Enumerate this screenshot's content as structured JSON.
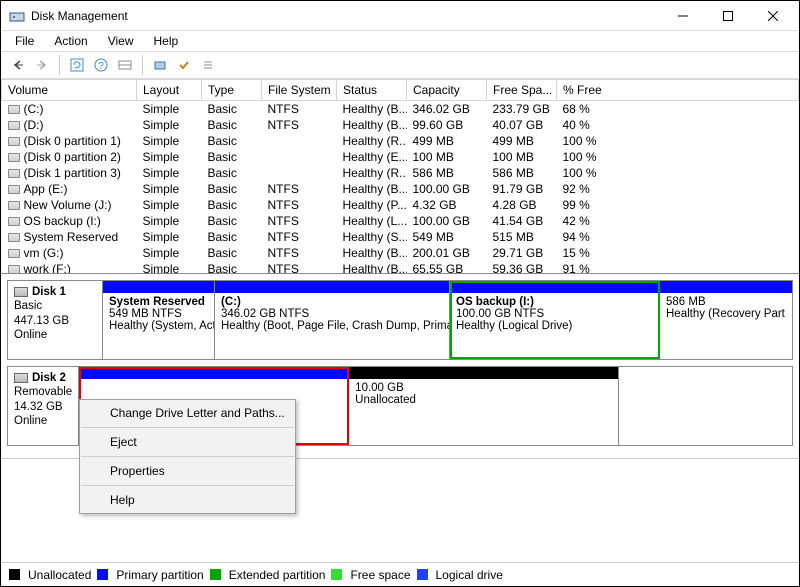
{
  "window": {
    "title": "Disk Management"
  },
  "menu": {
    "file": "File",
    "action": "Action",
    "view": "View",
    "help": "Help"
  },
  "columns": {
    "volume": "Volume",
    "layout": "Layout",
    "type": "Type",
    "fs": "File System",
    "status": "Status",
    "capacity": "Capacity",
    "free": "Free Spa...",
    "pct": "% Free"
  },
  "volumes": [
    {
      "name": "(C:)",
      "layout": "Simple",
      "type": "Basic",
      "fs": "NTFS",
      "status": "Healthy (B...",
      "cap": "346.02 GB",
      "free": "233.79 GB",
      "pct": "68 %"
    },
    {
      "name": "(D:)",
      "layout": "Simple",
      "type": "Basic",
      "fs": "NTFS",
      "status": "Healthy (B...",
      "cap": "99.60 GB",
      "free": "40.07 GB",
      "pct": "40 %"
    },
    {
      "name": "(Disk 0 partition 1)",
      "layout": "Simple",
      "type": "Basic",
      "fs": "",
      "status": "Healthy (R...",
      "cap": "499 MB",
      "free": "499 MB",
      "pct": "100 %"
    },
    {
      "name": "(Disk 0 partition 2)",
      "layout": "Simple",
      "type": "Basic",
      "fs": "",
      "status": "Healthy (E...",
      "cap": "100 MB",
      "free": "100 MB",
      "pct": "100 %"
    },
    {
      "name": "(Disk 1 partition 3)",
      "layout": "Simple",
      "type": "Basic",
      "fs": "",
      "status": "Healthy (R...",
      "cap": "586 MB",
      "free": "586 MB",
      "pct": "100 %"
    },
    {
      "name": "App (E:)",
      "layout": "Simple",
      "type": "Basic",
      "fs": "NTFS",
      "status": "Healthy (B...",
      "cap": "100.00 GB",
      "free": "91.79 GB",
      "pct": "92 %"
    },
    {
      "name": "New Volume (J:)",
      "layout": "Simple",
      "type": "Basic",
      "fs": "NTFS",
      "status": "Healthy (P...",
      "cap": "4.32 GB",
      "free": "4.28 GB",
      "pct": "99 %"
    },
    {
      "name": "OS backup (I:)",
      "layout": "Simple",
      "type": "Basic",
      "fs": "NTFS",
      "status": "Healthy (L...",
      "cap": "100.00 GB",
      "free": "41.54 GB",
      "pct": "42 %"
    },
    {
      "name": "System Reserved",
      "layout": "Simple",
      "type": "Basic",
      "fs": "NTFS",
      "status": "Healthy (S...",
      "cap": "549 MB",
      "free": "515 MB",
      "pct": "94 %"
    },
    {
      "name": "vm (G:)",
      "layout": "Simple",
      "type": "Basic",
      "fs": "NTFS",
      "status": "Healthy (B...",
      "cap": "200.01 GB",
      "free": "29.71 GB",
      "pct": "15 %"
    },
    {
      "name": "work (F:)",
      "layout": "Simple",
      "type": "Basic",
      "fs": "NTFS",
      "status": "Healthy (B...",
      "cap": "65.55 GB",
      "free": "59.36 GB",
      "pct": "91 %"
    }
  ],
  "disks": {
    "d1": {
      "name": "Disk 1",
      "type": "Basic",
      "size": "447.13 GB",
      "state": "Online"
    },
    "d2": {
      "name": "Disk 2",
      "type": "Removable",
      "size": "14.32 GB",
      "state": "Online"
    }
  },
  "d1parts": {
    "p0": {
      "name": "System Reserved",
      "line2": "549 MB NTFS",
      "line3": "Healthy (System, Activ"
    },
    "p1": {
      "name": "(C:)",
      "line2": "346.02 GB NTFS",
      "line3": "Healthy (Boot, Page File, Crash Dump, Primary P"
    },
    "p2": {
      "name": "OS backup  (I:)",
      "line2": "100.00 GB NTFS",
      "line3": "Healthy (Logical Drive)"
    },
    "p3": {
      "name": "",
      "line2": "586 MB",
      "line3": "Healthy (Recovery Part"
    }
  },
  "d2parts": {
    "p0": {
      "name": "",
      "line2": "",
      "line3": ""
    },
    "p1": {
      "name": "",
      "line2": "10.00 GB",
      "line3": "Unallocated"
    }
  },
  "context_menu": {
    "change": "Change Drive Letter and Paths...",
    "eject": "Eject",
    "props": "Properties",
    "help": "Help"
  },
  "legend": {
    "unalloc": "Unallocated",
    "primary": "Primary partition",
    "extended": "Extended partition",
    "free": "Free space",
    "logical": "Logical drive"
  }
}
